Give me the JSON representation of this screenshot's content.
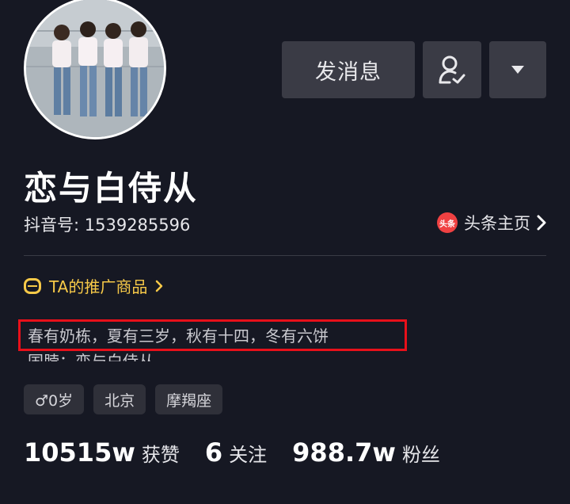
{
  "profile": {
    "name": "恋与白侍从",
    "uid_text": "抖音号: 1539285596",
    "toutiao_logo": "头条",
    "toutiao_label": "头条主页",
    "promo_label": "TA的推广商品",
    "bio_line1": "春有奶栋，夏有三岁，秋有十四，冬有六饼",
    "bio_line2": "国脖：恋与白侍从",
    "tags": [
      "♂0岁",
      "北京",
      "摩羯座"
    ],
    "stats": {
      "likes_num": "10515w",
      "likes_label": "获赞",
      "following_num": "6",
      "following_label": "关注",
      "fans_num": "988.7w",
      "fans_label": "粉丝"
    }
  },
  "actions": {
    "message_label": "发消息",
    "follow_icon": "user-check-icon",
    "more_icon": "caret-down-icon"
  },
  "colors": {
    "background": "#161823",
    "button": "#3a3b45",
    "promo": "#f7c948",
    "highlight_box": "#e8101a",
    "toutiao": "#f04142"
  }
}
